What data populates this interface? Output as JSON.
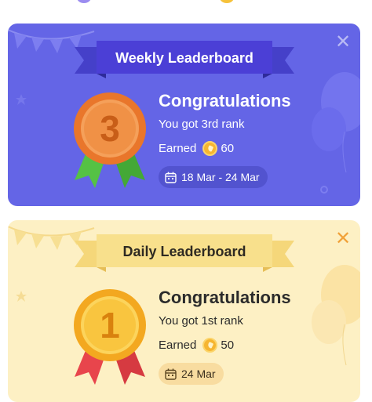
{
  "weekly": {
    "title": "Weekly Leaderboard",
    "congrats": "Congratulations",
    "rank_text": "You got 3rd rank",
    "earned_label": "Earned",
    "points": "60",
    "date_range": "18 Mar - 24 Mar",
    "medal_number": "3",
    "icons": [
      "close-icon",
      "medal-icon",
      "coin-icon",
      "calendar-icon"
    ],
    "colors": {
      "background": "#6465e6",
      "ribbon": "#4b3fd6",
      "medal": "#e9762b",
      "medal_ribbon": "#55c244"
    }
  },
  "daily": {
    "title": "Daily Leaderboard",
    "congrats": "Congratulations",
    "rank_text": "You got 1st rank",
    "earned_label": "Earned",
    "points": "50",
    "date": "24 Mar",
    "medal_number": "1",
    "icons": [
      "close-icon",
      "medal-icon",
      "coin-icon",
      "calendar-icon"
    ],
    "colors": {
      "background": "#fdf0c4",
      "ribbon": "#f8dc86",
      "medal": "#f3a820",
      "medal_ribbon": "#e8454c"
    }
  }
}
